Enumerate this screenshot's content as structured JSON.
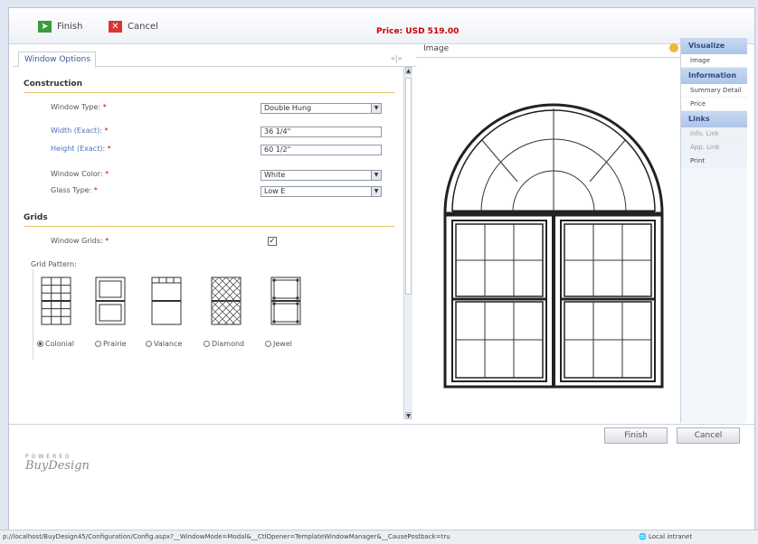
{
  "toolbar": {
    "finish_label": "Finish",
    "cancel_label": "Cancel",
    "price": "Price: USD 519.00"
  },
  "left_panel": {
    "tab_label": "Window Options",
    "collapse_symbol": "«|»",
    "construction": {
      "title": "Construction",
      "window_type_label": "Window Type:",
      "window_type_value": "Double Hung",
      "width_label": "Width (Exact):",
      "width_value": "36 1/4\"",
      "height_label": "Height (Exact):",
      "height_value": "60 1/2\"",
      "color_label": "Window Color:",
      "color_value": "White",
      "glass_label": "Glass Type:",
      "glass_value": "Low E"
    },
    "grids": {
      "title": "Grids",
      "window_grids_label": "Window Grids:",
      "window_grids_checked": true,
      "pattern_label": "Grid Pattern:",
      "patterns": [
        "Colonial",
        "Prairie",
        "Valance",
        "Diamond",
        "Jewel"
      ],
      "selected_pattern": "Colonial"
    },
    "required_marker": "*"
  },
  "image_panel": {
    "title": "Image"
  },
  "sidebar": {
    "visualize_header": "Visualize",
    "visualize_items": [
      "Image"
    ],
    "information_header": "Information",
    "information_items": [
      "Summary Detail",
      "Price"
    ],
    "links_header": "Links",
    "links_items": [
      "Info. Link",
      "App. Link",
      "Print"
    ]
  },
  "bottom": {
    "finish_label": "Finish",
    "cancel_label": "Cancel"
  },
  "logo": {
    "powered": "POWERED",
    "brand": "BuyDesign"
  },
  "statusbar": {
    "url": "p://localhost/BuyDesign45/Configuration/Config.aspx?__WindowMode=Modal&__CtlOpener=TemplateWindowManager&__CausePostback=tru",
    "zone": "Local intranet"
  }
}
